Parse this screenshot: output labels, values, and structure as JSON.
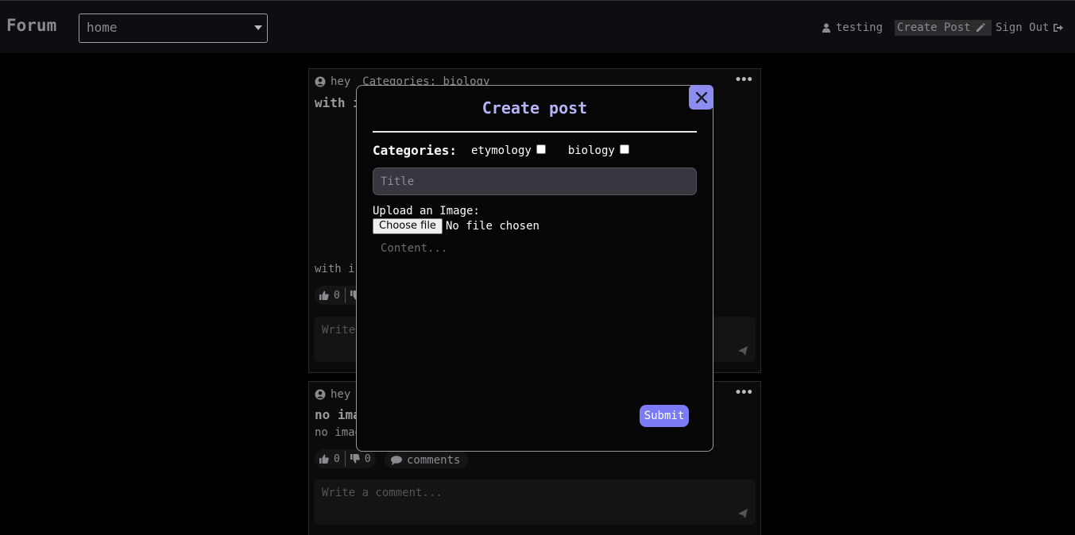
{
  "header": {
    "logo": "Forum",
    "board_select": "home",
    "user": "testing",
    "create_post": "Create Post",
    "sign_out": "Sign Out"
  },
  "posts": [
    {
      "author": "hey",
      "categories": "Categories: biology",
      "title": "with i",
      "body": "with i",
      "likes": "0",
      "comment_placeholder": "Write"
    },
    {
      "author": "hey",
      "title": "no ima",
      "body": "no imag",
      "likes": "0",
      "dislikes": "0",
      "comments_label": "comments",
      "comment_placeholder": "Write a comment..."
    }
  ],
  "modal": {
    "title": "Create post",
    "categories_label": "Categories:",
    "categories": [
      {
        "label": "etymology",
        "checked": false
      },
      {
        "label": "biology",
        "checked": false
      }
    ],
    "title_placeholder": "Title",
    "upload_label": "Upload an Image:",
    "choose_file": "Choose file",
    "no_file": "No file chosen",
    "content_placeholder": "Content...",
    "submit": "Submit"
  },
  "colors": {
    "accent": "#7b7cf5",
    "modal_title": "#b4b4f6",
    "background": "#000000",
    "header_bg": "#0d0e12"
  }
}
